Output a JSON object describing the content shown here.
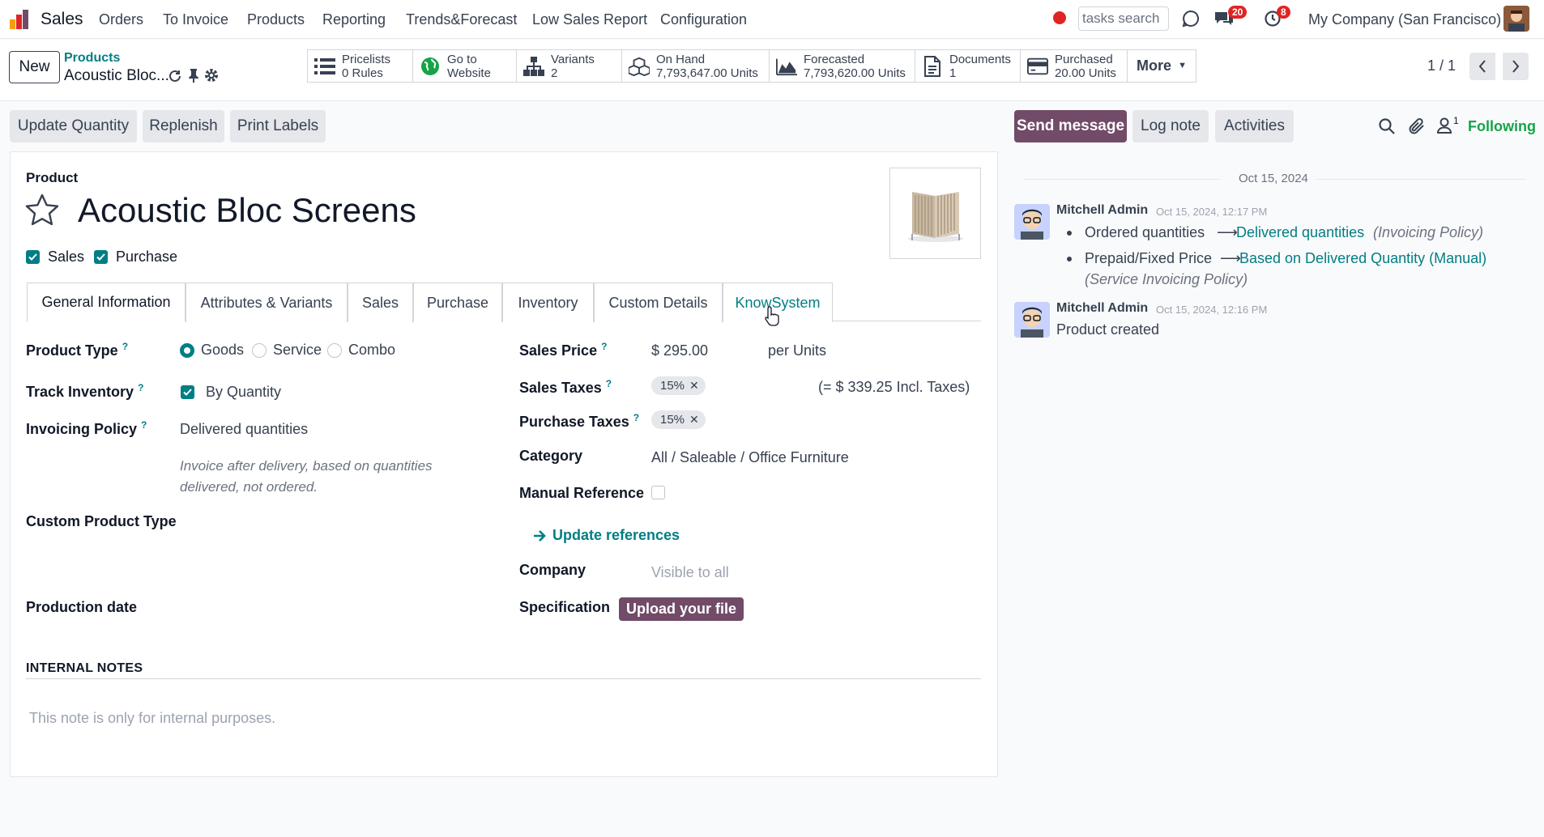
{
  "navbar": {
    "app_name": "Sales",
    "menu": [
      "Orders",
      "To Invoice",
      "Products",
      "Reporting",
      "Trends&Forecast",
      "Low Sales Report",
      "Configuration"
    ],
    "tasks_search_placeholder": "tasks search",
    "messages_count": "20",
    "activities_count": "8",
    "company": "My Company (San Francisco)"
  },
  "control": {
    "new_label": "New",
    "breadcrumb_parent": "Products",
    "breadcrumb_current": "Acoustic Bloc...",
    "smart_buttons": [
      {
        "icon": "list-icon",
        "line1": "Pricelists",
        "line2": "0 Rules"
      },
      {
        "icon": "globe-icon",
        "line1": "Go to",
        "line2": "Website"
      },
      {
        "icon": "sitemap-icon",
        "line1": "Variants",
        "line2": "2"
      },
      {
        "icon": "cubes-icon",
        "line1": "On Hand",
        "line2": "7,793,647.00 Units"
      },
      {
        "icon": "area-chart-icon",
        "line1": "Forecasted",
        "line2": "7,793,620.00 Units"
      },
      {
        "icon": "document-icon",
        "line1": "Documents",
        "line2": "1"
      },
      {
        "icon": "credit-card-icon",
        "line1": "Purchased",
        "line2": "20.00 Units"
      }
    ],
    "more_label": "More",
    "pager": "1 / 1"
  },
  "actions": {
    "update_quantity": "Update Quantity",
    "replenish": "Replenish",
    "print_labels": "Print Labels"
  },
  "form": {
    "product_caption": "Product",
    "product_name": "Acoustic Bloc Screens",
    "sales_check": "Sales",
    "purchase_check": "Purchase",
    "tabs": [
      "General Information",
      "Attributes & Variants",
      "Sales",
      "Purchase",
      "Inventory",
      "Custom Details",
      "KnowSystem"
    ],
    "product_type_label": "Product Type",
    "product_type_options": [
      "Goods",
      "Service",
      "Combo"
    ],
    "track_inventory_label": "Track Inventory",
    "track_inventory_value": "By Quantity",
    "invoicing_policy_label": "Invoicing Policy",
    "invoicing_policy_value": "Delivered quantities",
    "invoicing_policy_hint": "Invoice after delivery, based on quantities delivered, not ordered.",
    "custom_product_type_label": "Custom Product Type",
    "production_date_label": "Production date",
    "sales_price_label": "Sales Price",
    "sales_price_value": "$ 295.00",
    "sales_price_uom": "per Units",
    "sales_taxes_label": "Sales Taxes",
    "sales_taxes_tag": "15%",
    "sales_taxes_incl": "(= $ 339.25 Incl. Taxes)",
    "purchase_taxes_label": "Purchase Taxes",
    "purchase_taxes_tag": "15%",
    "category_label": "Category",
    "category_value": "All / Saleable / Office Furniture",
    "manual_reference_label": "Manual Reference",
    "update_references": "Update references",
    "company_label": "Company",
    "company_placeholder": "Visible to all",
    "specification_label": "Specification",
    "upload_label": "Upload your file",
    "internal_notes_title": "INTERNAL NOTES",
    "internal_notes_placeholder": "This note is only for internal purposes."
  },
  "chatter": {
    "send_message": "Send message",
    "log_note": "Log note",
    "activities": "Activities",
    "followers_count": "1",
    "following": "Following",
    "date_separator": "Oct 15, 2024",
    "messages": [
      {
        "author": "Mitchell Admin",
        "time": "Oct 15, 2024, 12:17 PM",
        "changes": [
          {
            "old": "Ordered quantities",
            "new": "Delivered quantities",
            "field": "(Invoicing Policy)"
          },
          {
            "old": "Prepaid/Fixed Price",
            "new": "Based on Delivered Quantity (Manual)",
            "field": "(Service Invoicing Policy)"
          }
        ]
      },
      {
        "author": "Mitchell Admin",
        "time": "Oct 15, 2024, 12:16 PM",
        "body": "Product created"
      }
    ]
  },
  "colors": {
    "brand": "#714b67",
    "accent": "#017e84",
    "badge": "#e02424"
  }
}
